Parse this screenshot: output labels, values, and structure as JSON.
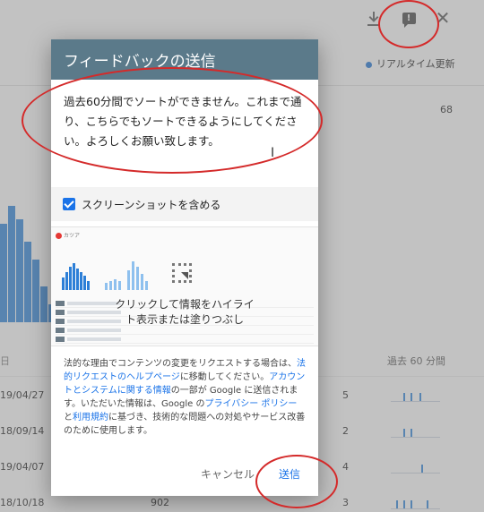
{
  "background": {
    "realtime_label": "リアルタイム更新",
    "count": "68",
    "date_header": "日",
    "last60_header": "過去 60 分間",
    "rows": [
      {
        "date": "19/04/27",
        "count": "5"
      },
      {
        "date": "18/09/14",
        "count": "2"
      },
      {
        "date": "19/04/07",
        "count": "4"
      },
      {
        "date": "18/10/18",
        "count": "3"
      }
    ],
    "misc_value": "902"
  },
  "dialog": {
    "title": "フィードバックの送信",
    "message": "過去60分間でソートができません。これまで通り、こちらでもソートできるようにしてください。よろしくお願い致します。",
    "include_screenshot_label": "スクリーンショットを含める",
    "screenshot_caption_1": "クリックして情報をハイライ",
    "screenshot_caption_2": "ト表示または塗りつぶし",
    "mini_app_name": "カツア",
    "legal": {
      "p1": "法的な理由でコンテンツの変更をリクエストする場合は、",
      "link1": "法的リクエストのヘルプページ",
      "p2": "に移動してください。",
      "link2": "アカウントとシステムに関する情報",
      "p3": "の一部が Google に送信されます。いただいた情報は、Google の",
      "link3": "プライバシー ポリシー",
      "p4": "と",
      "link4": "利用規約",
      "p5": "に基づき、技術的な問題への対処やサービス改善のために使用します。"
    },
    "cancel_label": "キャンセル",
    "send_label": "送信"
  },
  "colors": {
    "header": "#5b7a8a",
    "accent": "#1a73e8",
    "annotation": "#d42a2a"
  }
}
